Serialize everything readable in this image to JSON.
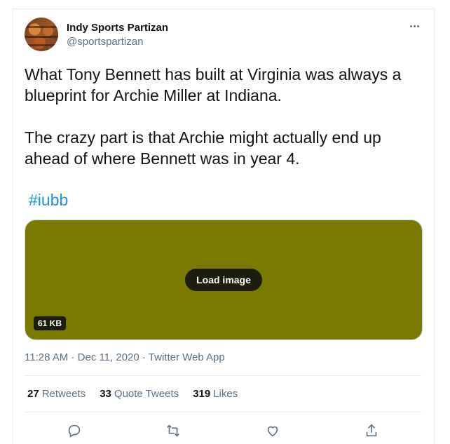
{
  "tweet": {
    "author": {
      "name": "Indy Sports Partizan",
      "handle": "@sportspartizan",
      "avatar_icon": "basketballs-avatar"
    },
    "more_icon": "more-options-icon",
    "text": {
      "paragraph1": "What Tony Bennett has built at Virginia was always a blueprint for Archie Miller at Indiana.",
      "paragraph2": "The crazy part is that Archie might actually end up ahead of where Bennett was in year 4."
    },
    "hashtag": "#iubb",
    "media": {
      "background_color": "#7a7a00",
      "load_label": "Load image",
      "size_label": "61 KB"
    },
    "meta": {
      "time": "11:28 AM",
      "separator1": " · ",
      "date": "Dec 11, 2020",
      "separator2": " · ",
      "source": "Twitter Web App"
    },
    "stats": [
      {
        "count": "27",
        "label": "Retweets"
      },
      {
        "count": "33",
        "label": "Quote Tweets"
      },
      {
        "count": "319",
        "label": "Likes"
      }
    ],
    "actions": [
      "reply-icon",
      "retweet-icon",
      "like-icon",
      "share-icon"
    ]
  },
  "colors": {
    "text_primary": "#0f1419",
    "text_secondary": "#5b7083",
    "hashtag": "#1b95e0",
    "border": "#ebeef0"
  }
}
